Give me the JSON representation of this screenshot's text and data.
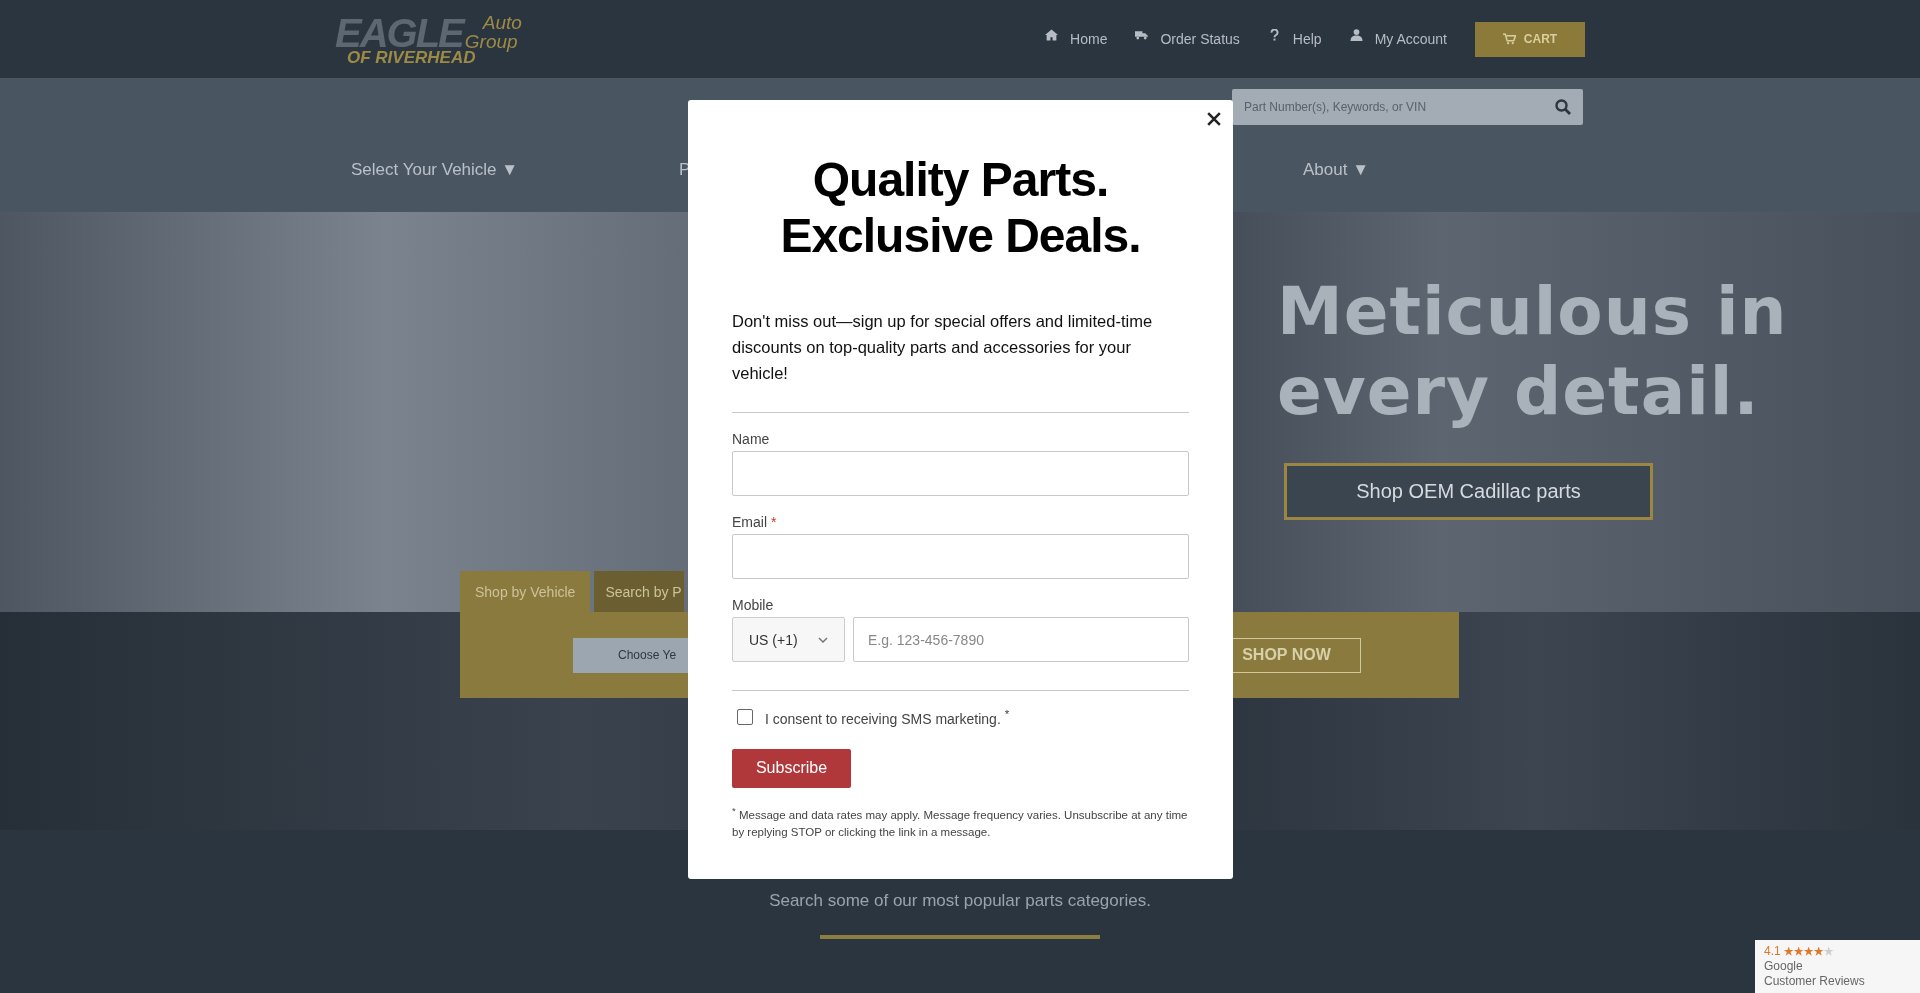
{
  "header": {
    "logo": {
      "word": "EAGLE",
      "line_1": "Auto",
      "line_2": "Group",
      "line_3": "OF RIVERHEAD"
    },
    "nav": [
      {
        "label": "Home",
        "kind": "home"
      },
      {
        "label": "Order Status",
        "kind": "truck"
      },
      {
        "label": "Help",
        "kind": "help"
      },
      {
        "label": "My Account",
        "kind": "account"
      }
    ],
    "cart": "CART"
  },
  "search": {
    "placeholder": "Part Number(s), Keywords, or VIN"
  },
  "menu": [
    {
      "label": "Select Your Vehicle ▼"
    },
    {
      "label": "P"
    },
    {
      "label": "About ▼"
    }
  ],
  "hero": {
    "headline": "Meticulous in every detail.",
    "button": "Shop OEM Cadillac parts"
  },
  "vehicle_search": {
    "tabs": [
      {
        "label": "Shop by Vehicle",
        "selected": true
      },
      {
        "label": "Search by P",
        "selected": false
      }
    ],
    "choose_button": "Choose Ye",
    "shop_button": "SHOP NOW"
  },
  "categories": {
    "subtitle": "Search some of our most popular parts categories."
  },
  "modal": {
    "title_lines": [
      "Quality Parts.",
      "Exclusive Deals."
    ],
    "intro": "Don't miss out—sign up for special offers and limited-time discounts on top-quality parts and accessories for your vehicle!",
    "fields": [
      {
        "kind": "text",
        "label": "Name"
      },
      {
        "kind": "text",
        "label": "Email",
        "required_mark": "*"
      },
      {
        "kind": "phone",
        "label": "Mobile",
        "country": "US (+1)",
        "placeholder": "E.g. 123-456-7890"
      }
    ],
    "consent": {
      "label": "I consent to receiving SMS marketing. $^{*}$",
      "checked": false
    },
    "button": "Subscribe",
    "footnote": "$^{*}$ Message and data rates may apply. Message frequency varies. Unsubscribe at any time by replying STOP or clicking the link in a message."
  },
  "reviews_badge": {
    "rating": "4.1",
    "stars": 4,
    "line_1": "Google",
    "line_2": "Customer Reviews"
  }
}
